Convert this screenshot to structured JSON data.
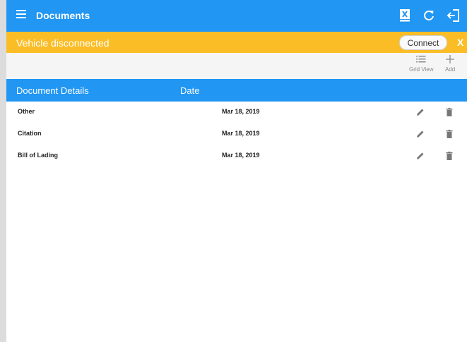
{
  "app_bar": {
    "title": "Documents",
    "icons": [
      "menu-icon",
      "bluetooth-disconnected-icon",
      "refresh-icon",
      "logout-icon"
    ]
  },
  "banner": {
    "message": "Vehicle disconnected",
    "connect_label": "Connect",
    "close_label": "X",
    "color": "#fbbd26"
  },
  "toolbar": {
    "grid_view_label": "Grid View",
    "add_label": "Add"
  },
  "table": {
    "headers": [
      "Document Details",
      "Date"
    ],
    "rows": [
      {
        "name": "Other",
        "date": "Mar 18, 2019"
      },
      {
        "name": "Citation",
        "date": "Mar 18, 2019"
      },
      {
        "name": "Bill of Lading",
        "date": "Mar 18, 2019"
      }
    ]
  },
  "colors": {
    "primary": "#2196f3",
    "warning": "#fbbd26"
  }
}
